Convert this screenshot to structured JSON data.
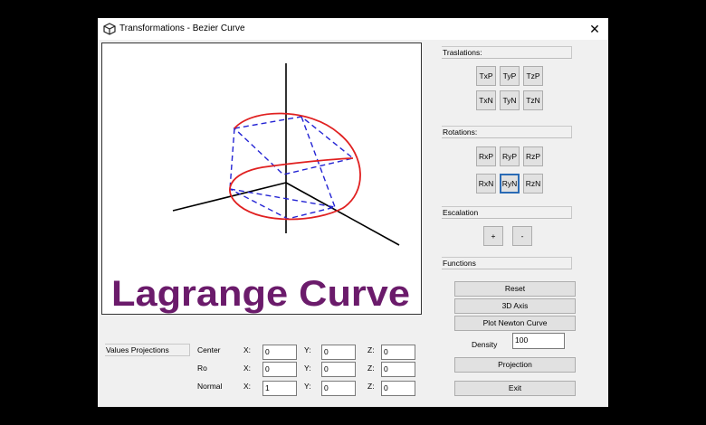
{
  "window": {
    "title": "Transformations - Bezier Curve",
    "close_symbol": "✕",
    "app_icon": "cube-icon"
  },
  "canvas": {
    "caption": "Lagrange Curve",
    "caption_color": "#6b1b6b",
    "curve_color": "#e02020",
    "dash_color": "#2020d0"
  },
  "translations": {
    "header": "Traslations:",
    "buttons": [
      "TxP",
      "TyP",
      "TzP",
      "TxN",
      "TyN",
      "TzN"
    ]
  },
  "rotations": {
    "header": "Rotations:",
    "buttons": [
      "RxP",
      "RyP",
      "RzP",
      "RxN",
      "RyN",
      "RzN"
    ],
    "focused": "RyN"
  },
  "escalation": {
    "header": "Escalation",
    "plus": "+",
    "minus": "-"
  },
  "functions": {
    "header": "Functions",
    "reset": "Reset",
    "axis3d": "3D Axis",
    "plot_newton": "Plot Newton Curve",
    "density_label": "Density",
    "density_value": "100",
    "projection": "Projection",
    "exit": "Exit"
  },
  "projections": {
    "header": "Values Projections",
    "axis_labels": {
      "x": "X:",
      "y": "Y:",
      "z": "Z:"
    },
    "rows": [
      {
        "label": "Center",
        "x": "0",
        "y": "0",
        "z": "0"
      },
      {
        "label": "Ro",
        "x": "0",
        "y": "0",
        "z": "0"
      },
      {
        "label": "Normal",
        "x": "1",
        "y": "0",
        "z": "0"
      }
    ]
  }
}
